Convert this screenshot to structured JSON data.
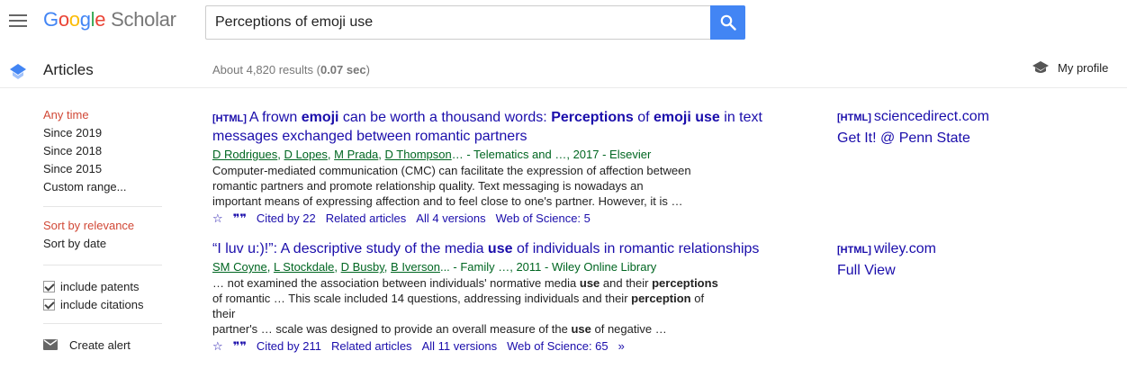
{
  "header": {
    "menu_icon": "hamburger-menu-icon",
    "logo_letters": [
      "G",
      "o",
      "o",
      "g",
      "l",
      "e"
    ],
    "logo_scholar": "Scholar",
    "search_value": "Perceptions of emoji use",
    "search_icon": "search-icon",
    "accent_color": "#4285f4"
  },
  "subbar": {
    "section_label": "Articles",
    "results_prefix": "About 4,820 results (",
    "results_time": "0.07 sec",
    "results_suffix": ")",
    "profile_label": "My profile"
  },
  "sidebar": {
    "time_filters": [
      "Any time",
      "Since 2019",
      "Since 2018",
      "Since 2015",
      "Custom range..."
    ],
    "sort_options": [
      "Sort by relevance",
      "Sort by date"
    ],
    "checks": [
      "include patents",
      "include citations"
    ],
    "alert_label": "Create alert",
    "active_color": "#d14836"
  },
  "results": [
    {
      "tag": "[HTML]",
      "authors": [
        "D Rodrigues",
        "D Lopes",
        "M Prada",
        "D Thompson"
      ],
      "source": "… - Telematics and …, 2017 - Elsevier",
      "snippet_lines": [
        "Computer-mediated communication (CMC) can facilitate the expression of affection between",
        "romantic partners and promote relationship quality. Text messaging is nowadays an",
        "important means of expressing affection and to feel close to one's partner. However, it is …"
      ],
      "actions": [
        "Cited by 22",
        "Related articles",
        "All 4 versions",
        "Web of Science: 5"
      ],
      "side_tag": "[HTML]",
      "side_domain": "sciencedirect.com",
      "side_extra": "Get It! @ Penn State"
    },
    {
      "tag": "",
      "authors": [
        "SM Coyne",
        "L Stockdale",
        "D Busby",
        "B Iverson"
      ],
      "source": "... - Family …, 2011 - Wiley Online Library",
      "actions": [
        "Cited by 211",
        "Related articles",
        "All 11 versions",
        "Web of Science: 65"
      ],
      "side_tag": "[HTML]",
      "side_domain": "wiley.com",
      "side_extra": "Full View"
    }
  ]
}
